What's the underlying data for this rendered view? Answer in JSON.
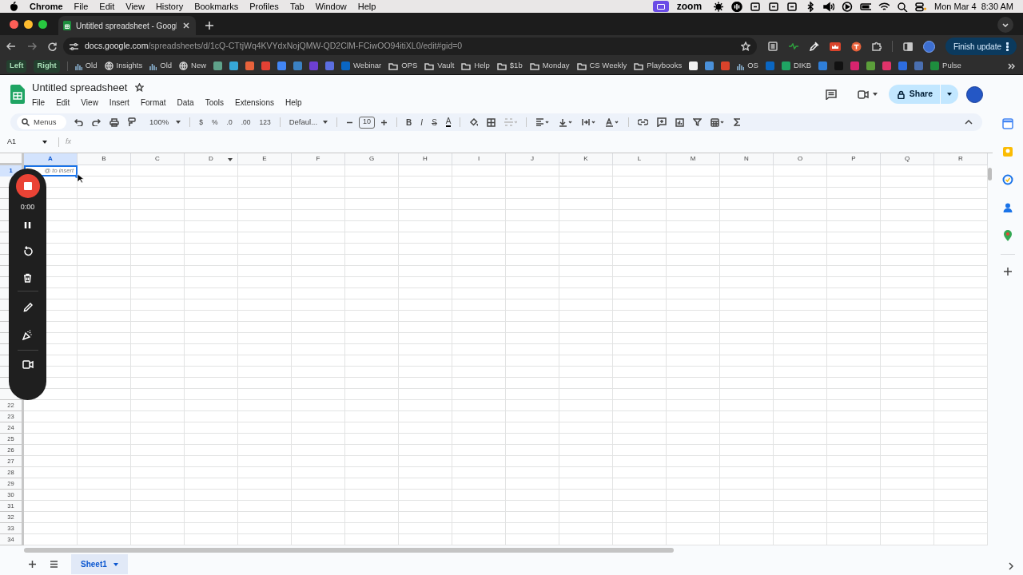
{
  "menubar": {
    "app": "Chrome",
    "menus": [
      "File",
      "Edit",
      "View",
      "History",
      "Bookmarks",
      "Profiles",
      "Tab",
      "Window",
      "Help"
    ],
    "zoom_label": "zoom",
    "date": "Mon Mar 4",
    "time": "8:30 AM"
  },
  "browser": {
    "tab_title": "Untitled spreadsheet - Googl",
    "url_host": "docs.google.com",
    "url_path": "/spreadsheets/d/1cQ-CTtjWq4KVYdxNojQMW-QD2ClM-FCiwOO94itiXL0/edit#gid=0",
    "update_button": "Finish update"
  },
  "bookmarks": [
    {
      "kind": "group",
      "label": "Left"
    },
    {
      "kind": "group",
      "label": "Right"
    },
    {
      "kind": "chart",
      "label": "Old"
    },
    {
      "kind": "globe",
      "label": "Insights"
    },
    {
      "kind": "chart",
      "label": "Old"
    },
    {
      "kind": "globe",
      "label": "New"
    },
    {
      "kind": "app",
      "color": "#5fa28a"
    },
    {
      "kind": "app",
      "color": "#36a7d8"
    },
    {
      "kind": "app",
      "color": "#e8623b"
    },
    {
      "kind": "app",
      "color": "#e44134"
    },
    {
      "kind": "app",
      "color": "#4285f4"
    },
    {
      "kind": "app",
      "color": "#3b82c4"
    },
    {
      "kind": "app",
      "color": "#6d3fd1"
    },
    {
      "kind": "app",
      "color": "#5b6ee1"
    },
    {
      "kind": "app",
      "color": "#0a66c2",
      "label": "Webinar"
    },
    {
      "kind": "folder",
      "label": "OPS"
    },
    {
      "kind": "folder",
      "label": "Vault"
    },
    {
      "kind": "folder",
      "label": "Help"
    },
    {
      "kind": "folder",
      "label": "$1b"
    },
    {
      "kind": "folder",
      "label": "Monday"
    },
    {
      "kind": "folder",
      "label": "CS Weekly"
    },
    {
      "kind": "folder",
      "label": "Playbooks"
    },
    {
      "kind": "app",
      "color": "#f2f2f2"
    },
    {
      "kind": "app",
      "color": "#4a90d9"
    },
    {
      "kind": "app",
      "color": "#d9432b"
    },
    {
      "kind": "chart",
      "label": "OS"
    },
    {
      "kind": "app",
      "color": "#0a66c2"
    },
    {
      "kind": "app",
      "color": "#1fa463",
      "label": "DIKB"
    },
    {
      "kind": "app",
      "color": "#2f7ed8"
    },
    {
      "kind": "app",
      "color": "#111111"
    },
    {
      "kind": "app",
      "color": "#d6246e"
    },
    {
      "kind": "app",
      "color": "#5b9e3a"
    },
    {
      "kind": "app",
      "color": "#e0336a"
    },
    {
      "kind": "app",
      "color": "#2d6cdf"
    },
    {
      "kind": "app",
      "color": "#4a6fb0"
    },
    {
      "kind": "app",
      "color": "#1e8e3e",
      "label": "Pulse"
    }
  ],
  "sheets": {
    "title": "Untitled spreadsheet",
    "starred": false,
    "menus": [
      "File",
      "Edit",
      "View",
      "Insert",
      "Format",
      "Data",
      "Tools",
      "Extensions",
      "Help"
    ],
    "share_button": "Share",
    "toolbar": {
      "search": "Menus",
      "zoom": "100%",
      "number_formats": [
        "$",
        "%",
        ".0",
        ".00",
        "123"
      ],
      "font": "Defaul...",
      "font_size": "10",
      "bold": "B",
      "italic": "I",
      "strikethrough": "S",
      "text_color": "A"
    },
    "name_box": "A1",
    "formula_label": "fx",
    "columns": [
      {
        "label": "A",
        "selected": true
      },
      {
        "label": "B",
        "selected": false
      },
      {
        "label": "C",
        "selected": false
      },
      {
        "label": "D",
        "selected": false
      },
      {
        "label": "E",
        "selected": false
      },
      {
        "label": "F",
        "selected": false
      },
      {
        "label": "G",
        "selected": false
      },
      {
        "label": "H",
        "selected": false
      },
      {
        "label": "I",
        "selected": false
      },
      {
        "label": "J",
        "selected": false
      },
      {
        "label": "K",
        "selected": false
      },
      {
        "label": "L",
        "selected": false
      },
      {
        "label": "M",
        "selected": false
      },
      {
        "label": "N",
        "selected": false
      },
      {
        "label": "O",
        "selected": false
      },
      {
        "label": "P",
        "selected": false
      },
      {
        "label": "Q",
        "selected": false
      },
      {
        "label": "R",
        "selected": false
      }
    ],
    "rows": [
      {
        "label": "1",
        "selected": true
      },
      {
        "label": "22",
        "selected": false
      },
      {
        "label": "23",
        "selected": false
      },
      {
        "label": "24",
        "selected": false
      },
      {
        "label": "25",
        "selected": false
      },
      {
        "label": "26",
        "selected": false
      },
      {
        "label": "27",
        "selected": false
      },
      {
        "label": "28",
        "selected": false
      },
      {
        "label": "29",
        "selected": false
      },
      {
        "label": "30",
        "selected": false
      },
      {
        "label": "31",
        "selected": false
      },
      {
        "label": "32",
        "selected": false
      },
      {
        "label": "33",
        "selected": false
      },
      {
        "label": "34",
        "selected": false
      }
    ],
    "active_cell": {
      "placeholder": "@ to insert"
    },
    "sheet_tabs": [
      {
        "label": "Sheet1",
        "selected": true
      }
    ]
  },
  "recorder": {
    "timer": "0:00"
  }
}
